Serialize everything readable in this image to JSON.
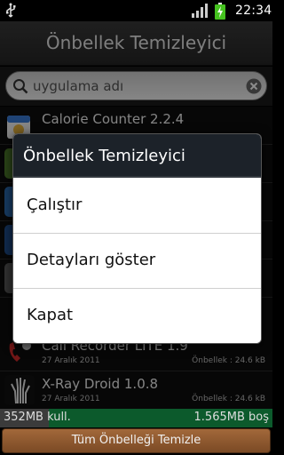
{
  "status_bar": {
    "time": "22:34",
    "icons": [
      "usb-icon",
      "signal-icon",
      "battery-charging-icon"
    ]
  },
  "app": {
    "title": "Önbellek Temizleyici"
  },
  "search": {
    "placeholder": "uygulama adı",
    "value": ""
  },
  "apps": [
    {
      "name": "Calorie Counter 2.2.4",
      "date": "",
      "cache": "",
      "icon": "calorie-counter-icon"
    },
    {
      "name": "",
      "date": "",
      "cache": "",
      "icon": "app-icon"
    },
    {
      "name": "",
      "date": "",
      "cache": "",
      "icon": "app-icon"
    },
    {
      "name": "",
      "date": "",
      "cache": "",
      "icon": "app-icon"
    },
    {
      "name": "",
      "date": "",
      "cache": "",
      "icon": "app-icon"
    },
    {
      "name": "Call Recorder LITE 1.9",
      "date": "27 Aralık 2011",
      "cache": "Önbellek : 24.6 kB",
      "icon": "call-recorder-icon"
    },
    {
      "name": "X-Ray Droid 1.0.8",
      "date": "27 Aralık 2011",
      "cache": "Önbellek : 24.6 kB",
      "icon": "xray-hand-icon"
    }
  ],
  "storage": {
    "used": "352MB kull.",
    "free": "1.565MB boş",
    "used_fraction": 0.18
  },
  "clear_all_button": "Tüm Önbelleği Temizle",
  "dialog": {
    "title": "Önbellek Temizleyici",
    "items": [
      "Çalıştır",
      "Detayları göster",
      "Kapat"
    ]
  },
  "colors": {
    "dialog_title_bg": "#1c2229",
    "storage_free": "#0c5a2c",
    "button": "#8f5930"
  }
}
